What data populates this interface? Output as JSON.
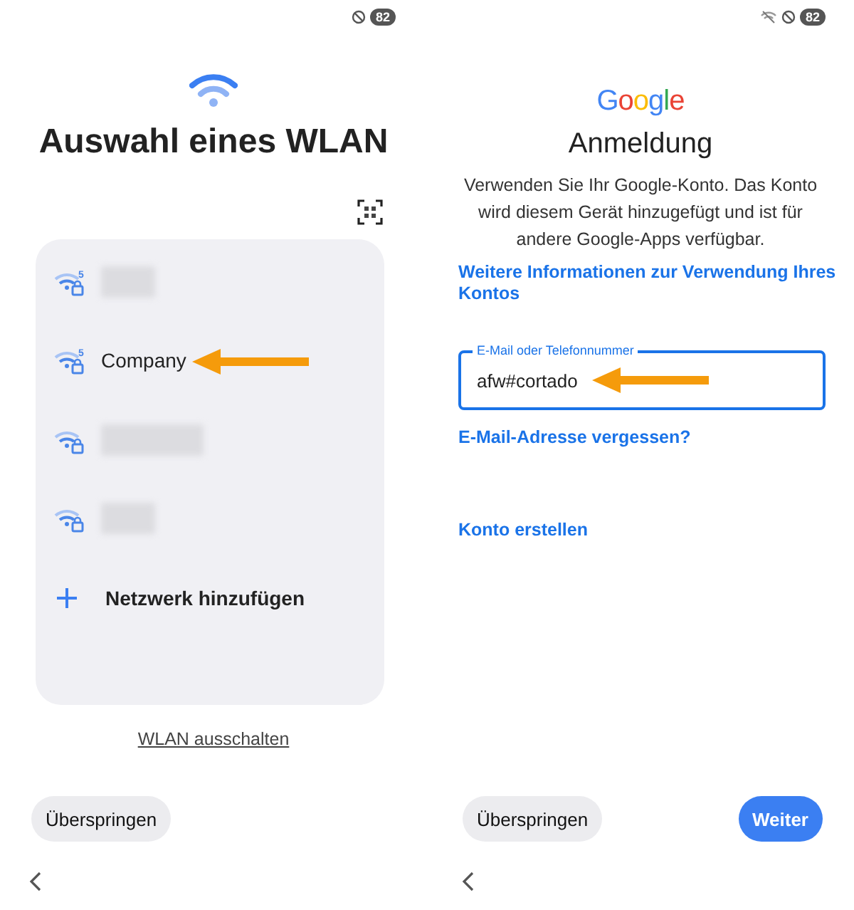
{
  "left": {
    "status": {
      "battery": "82"
    },
    "title": "Auswahl eines WLAN",
    "networks": [
      {
        "kind": "blurred",
        "band": "5"
      },
      {
        "kind": "named",
        "name": "Company",
        "band": "5",
        "annotated": true
      },
      {
        "kind": "blurred"
      },
      {
        "kind": "blurred"
      },
      {
        "kind": "add",
        "name": "Netzwerk hinzufügen"
      }
    ],
    "wifi_off_link": "WLAN ausschalten",
    "skip_button": "Überspringen"
  },
  "right": {
    "status": {
      "battery": "82"
    },
    "logo": "Google",
    "title": "Anmeldung",
    "description": "Verwenden Sie Ihr Google-Konto. Das Konto wird diesem Gerät hinzugefügt und ist für andere Google-Apps verfügbar.",
    "info_link": "Weitere Informationen zur Verwendung Ihres Kontos",
    "email_field": {
      "label": "E-Mail oder Telefonnummer",
      "value": "afw#cortado",
      "focused": true,
      "annotated": true
    },
    "forgot_link": "E-Mail-Adresse vergessen?",
    "create_link": "Konto erstellen",
    "skip_button": "Überspringen",
    "next_button": "Weiter"
  }
}
